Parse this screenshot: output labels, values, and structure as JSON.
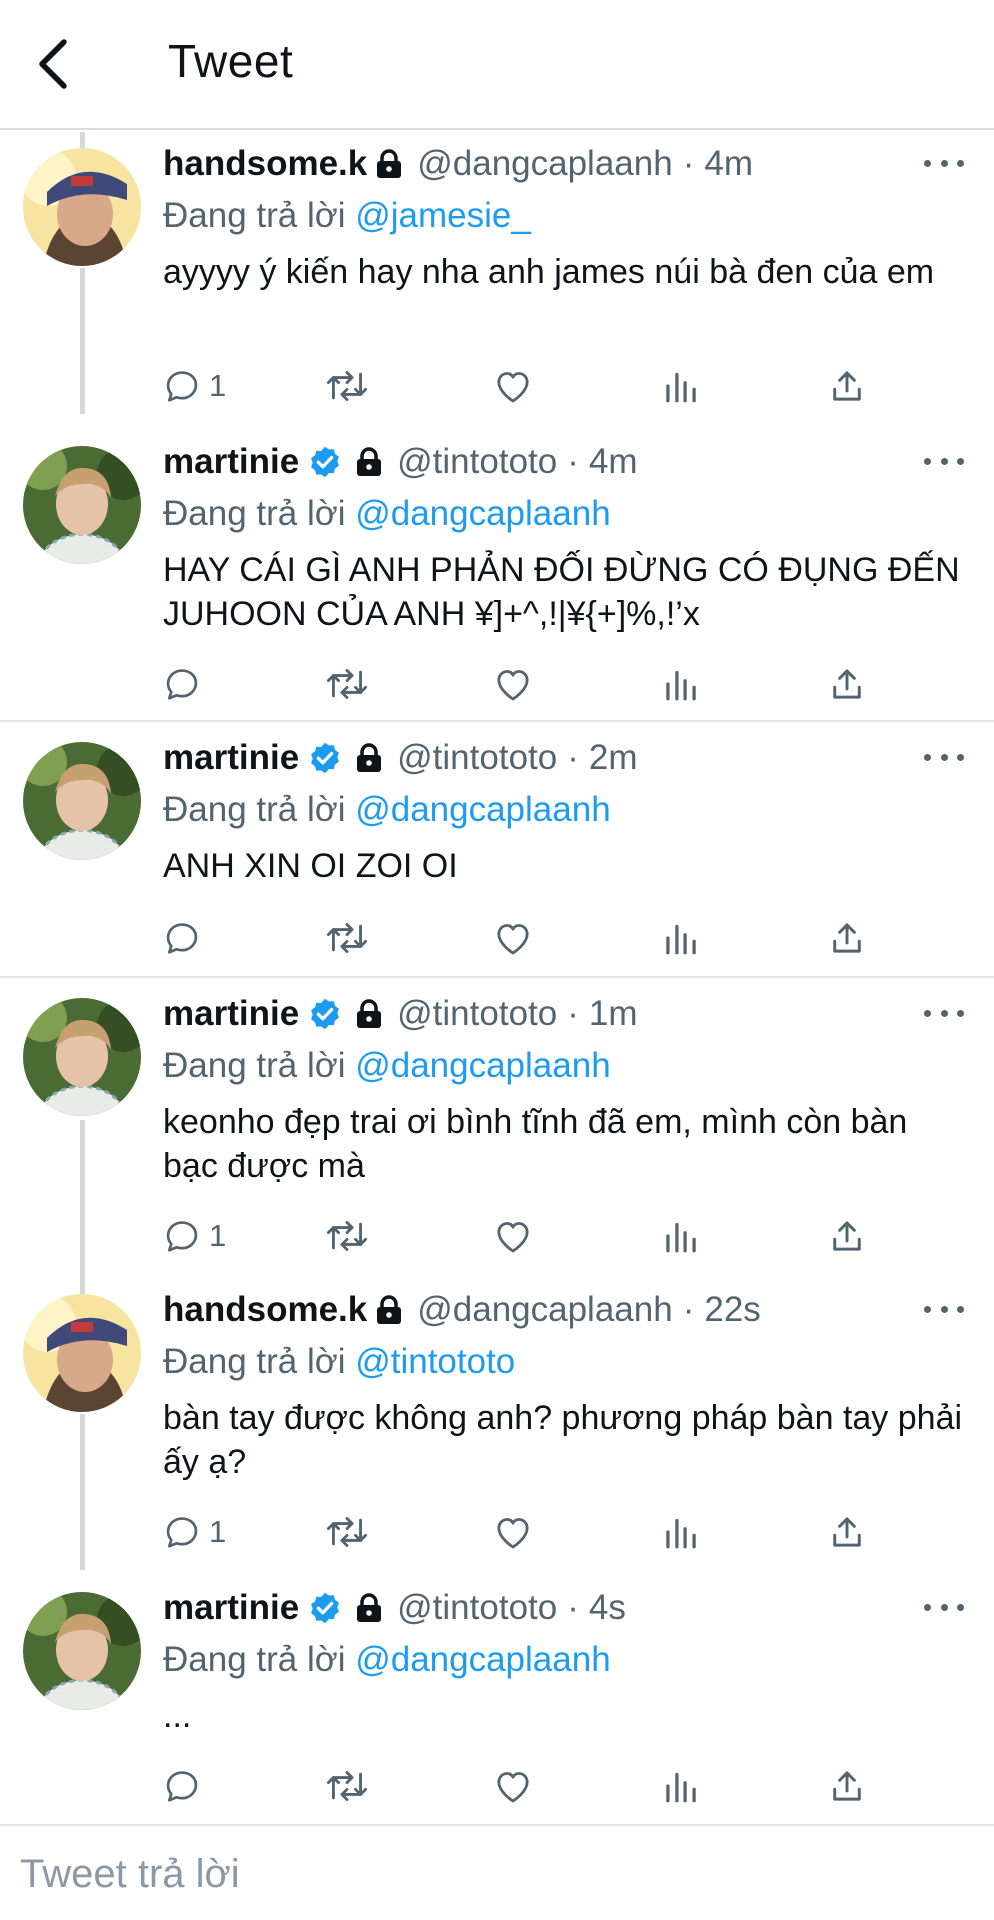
{
  "header": {
    "title": "Tweet",
    "back_icon": "chevron-left-icon"
  },
  "colors": {
    "accent": "#1d9bf0",
    "muted": "#536471",
    "text": "#0f1419",
    "divider": "#e6e9ec"
  },
  "replying_prefix": "Đang trả lời",
  "tweets": [
    {
      "name": "handsome.k",
      "handle": "@dangcaplaanh",
      "sep": "·",
      "time": "4m",
      "verified": false,
      "locked": true,
      "replying_to": "@jamesie_",
      "text": "ayyyy ý kiến hay nha anh james núi bà đen của em",
      "reply_count": "1"
    },
    {
      "name": "martinie",
      "handle": "@tintototo",
      "sep": "·",
      "time": "4m",
      "verified": true,
      "locked": true,
      "replying_to": "@dangcaplaanh",
      "text": "HAY CÁI GÌ ANH PHẢN ĐỐI ĐỪNG CÓ ĐỤNG ĐẾN JUHOON CỦA ANH ¥]+^,!|¥{+]%,!’x",
      "reply_count": ""
    },
    {
      "name": "martinie",
      "handle": "@tintototo",
      "sep": "·",
      "time": "2m",
      "verified": true,
      "locked": true,
      "replying_to": "@dangcaplaanh",
      "text": "ANH XIN OI ZOI OI",
      "reply_count": ""
    },
    {
      "name": "martinie",
      "handle": "@tintototo",
      "sep": "·",
      "time": "1m",
      "verified": true,
      "locked": true,
      "replying_to": "@dangcaplaanh",
      "text": "keonho đẹp trai ơi bình tĩnh đã em, mình còn bàn bạc được mà",
      "reply_count": "1"
    },
    {
      "name": "handsome.k",
      "handle": "@dangcaplaanh",
      "sep": "·",
      "time": "22s",
      "verified": false,
      "locked": true,
      "replying_to": "@tintototo",
      "text": "bàn tay được không anh? phương pháp bàn tay phải ấy ạ?",
      "reply_count": "1"
    },
    {
      "name": "martinie",
      "handle": "@tintototo",
      "sep": "·",
      "time": "4s",
      "verified": true,
      "locked": true,
      "replying_to": "@dangcaplaanh",
      "text": "...",
      "reply_count": ""
    }
  ],
  "action_icons": [
    "reply-icon",
    "retweet-icon",
    "like-icon",
    "analytics-icon",
    "share-icon"
  ],
  "composer": {
    "placeholder": "Tweet trả lời"
  }
}
